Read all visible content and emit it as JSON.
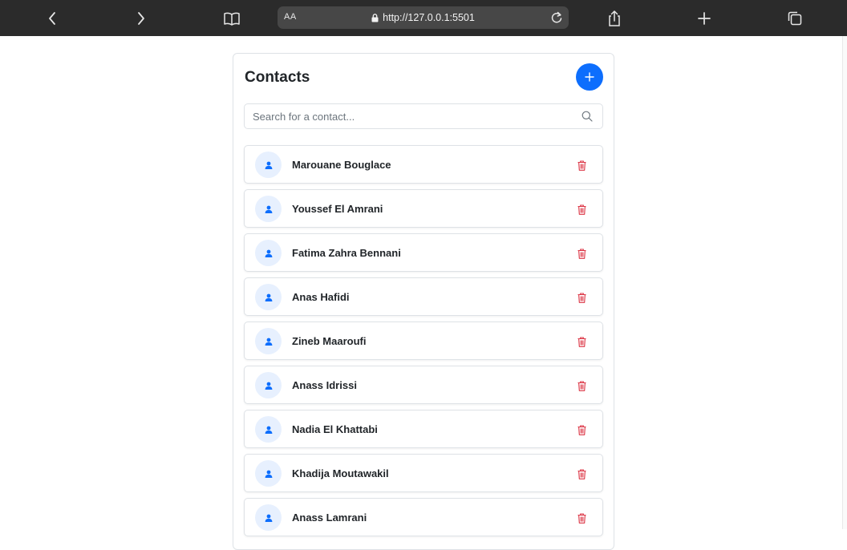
{
  "browser": {
    "text_size_label": "AA",
    "url": "http://127.0.0.1:5501",
    "icons": [
      "back-icon",
      "forward-icon",
      "reader-icon",
      "lock-icon",
      "reload-icon",
      "share-icon",
      "new-tab-icon",
      "tabs-icon"
    ]
  },
  "app": {
    "title": "Contacts",
    "search": {
      "placeholder": "Search for a contact...",
      "value": ""
    },
    "colors": {
      "accent": "#0d6efd",
      "delete": "#dc3545",
      "avatar_bg": "#e7f0fe"
    },
    "contacts": [
      {
        "name": "Marouane Bouglace"
      },
      {
        "name": "Youssef El Amrani"
      },
      {
        "name": "Fatima Zahra Bennani"
      },
      {
        "name": "Anas Hafidi"
      },
      {
        "name": "Zineb Maaroufi"
      },
      {
        "name": "Anass Idrissi"
      },
      {
        "name": "Nadia El Khattabi"
      },
      {
        "name": "Khadija Moutawakil"
      },
      {
        "name": "Anass Lamrani"
      }
    ]
  }
}
